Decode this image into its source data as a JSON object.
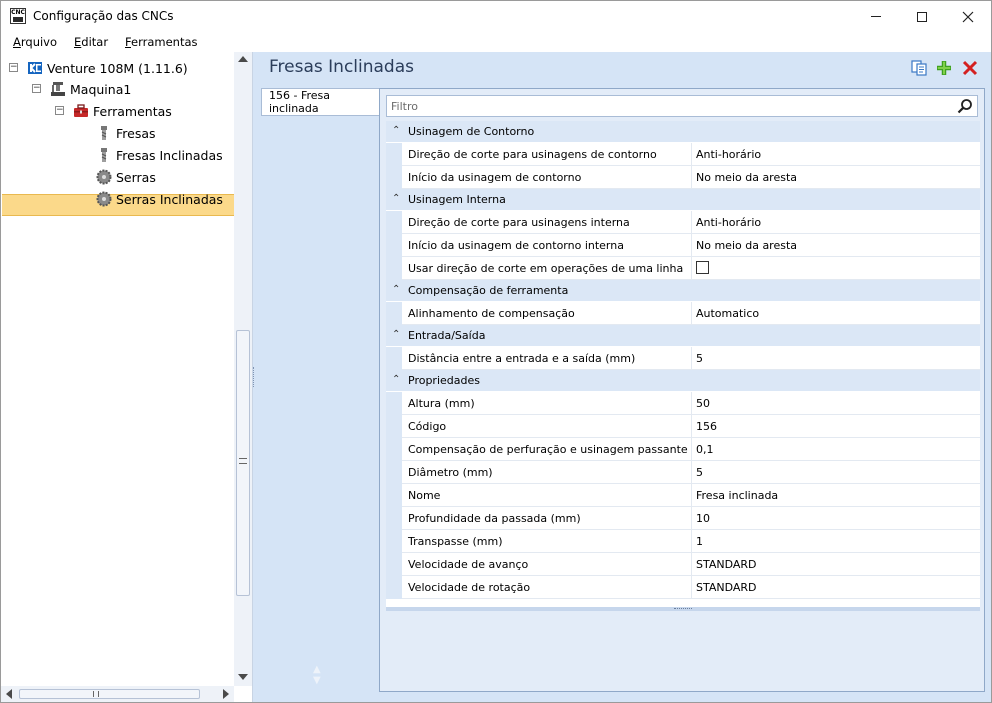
{
  "window": {
    "title": "Configuração das CNCs",
    "app_icon": "cnc-icon"
  },
  "menu": [
    {
      "label": "Arquivo",
      "underline": "A",
      "rest": "rquivo"
    },
    {
      "label": "Editar",
      "underline": "E",
      "rest": "ditar"
    },
    {
      "label": "Ferramentas",
      "underline": "F",
      "rest": "erramentas"
    }
  ],
  "tree": {
    "root": {
      "label": "Venture 108M (1.11.6)",
      "icon": "cnc-logo-icon"
    },
    "machine": {
      "label": "Maquina1",
      "icon": "machine-icon"
    },
    "tools": {
      "label": "Ferramentas",
      "icon": "toolbox-icon"
    },
    "items": [
      {
        "label": "Fresas",
        "icon": "drill-bit-icon"
      },
      {
        "label": "Fresas Inclinadas",
        "icon": "drill-bit-icon",
        "selected": true
      },
      {
        "label": "Serras",
        "icon": "saw-blade-icon"
      },
      {
        "label": "Serras Inclinadas",
        "icon": "saw-blade-icon"
      }
    ]
  },
  "panel": {
    "title": "Fresas Inclinadas",
    "tab_label": "156 - Fresa inclinada",
    "filter_placeholder": "Filtro"
  },
  "colors": {
    "selection": "#fbd98a",
    "panel_bg": "#d5e4f6",
    "category_bg": "#dbe7f6",
    "add_icon": "#3ea020",
    "delete_icon": "#d42020"
  },
  "categories": [
    {
      "label": "Usinagem de Contorno",
      "rows": [
        {
          "name": "Direção de corte para usinagens de contorno",
          "value": "Anti-horário"
        },
        {
          "name": "Início da usinagem de contorno",
          "value": "No meio da aresta"
        }
      ]
    },
    {
      "label": "Usinagem Interna",
      "rows": [
        {
          "name": "Direção de corte para usinagens interna",
          "value": "Anti-horário"
        },
        {
          "name": "Início da usinagem de contorno interna",
          "value": "No meio da aresta"
        },
        {
          "name": "Usar direção de corte em operações de uma linha",
          "value": "",
          "checkbox": false
        }
      ]
    },
    {
      "label": "Compensação de ferramenta",
      "rows": [
        {
          "name": "Alinhamento de compensação",
          "value": "Automatico"
        }
      ]
    },
    {
      "label": "Entrada/Saída",
      "rows": [
        {
          "name": "Distância entre a entrada e a saída (mm)",
          "value": "5"
        }
      ]
    },
    {
      "label": "Propriedades",
      "rows": [
        {
          "name": "Altura (mm)",
          "value": "50"
        },
        {
          "name": "Código",
          "value": "156"
        },
        {
          "name": "Compensação de perfuração e usinagem passante (mm)",
          "value": "0,1"
        },
        {
          "name": "Diâmetro (mm)",
          "value": "5"
        },
        {
          "name": "Nome",
          "value": "Fresa inclinada"
        },
        {
          "name": "Profundidade da passada (mm)",
          "value": "10"
        },
        {
          "name": "Transpasse (mm)",
          "value": "1"
        },
        {
          "name": "Velocidade de avanço",
          "value": "STANDARD"
        },
        {
          "name": "Velocidade de rotação",
          "value": "STANDARD"
        }
      ]
    }
  ]
}
